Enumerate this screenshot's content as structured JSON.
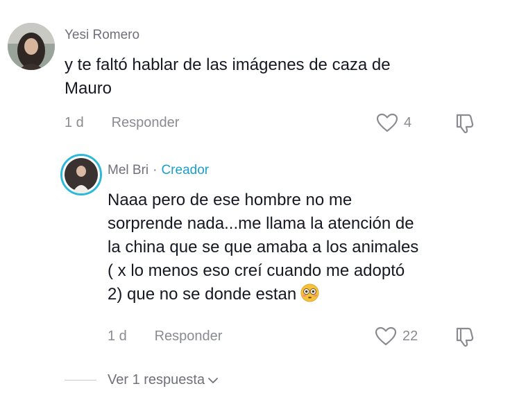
{
  "comments": [
    {
      "username": "Yesi Romero",
      "text_line1": "y te faltó hablar de las imágenes de caza de",
      "text_line2": "Mauro",
      "time": "1 d",
      "reply_label": "Responder",
      "likes": "4",
      "avatar_icon": "user-avatar-photo"
    },
    {
      "username": "Mel Bri",
      "separator": "·",
      "badge": "Creador",
      "text_lines": [
        "Naaa pero de ese hombre no me",
        "sorprende nada...me llama la atención de",
        "la china que se que amaba a los animales",
        "( x lo menos eso creí cuando me adoptó",
        "2) que no se donde estan"
      ],
      "emoji": "flushed-face-emoji",
      "time": "1 d",
      "reply_label": "Responder",
      "likes": "22",
      "avatar_icon": "creator-avatar-photo"
    }
  ],
  "view_replies_label": "Ver 1 respuesta",
  "colors": {
    "creator": "#1a9fc9",
    "text": "#161823",
    "muted": "#8a8b91"
  }
}
